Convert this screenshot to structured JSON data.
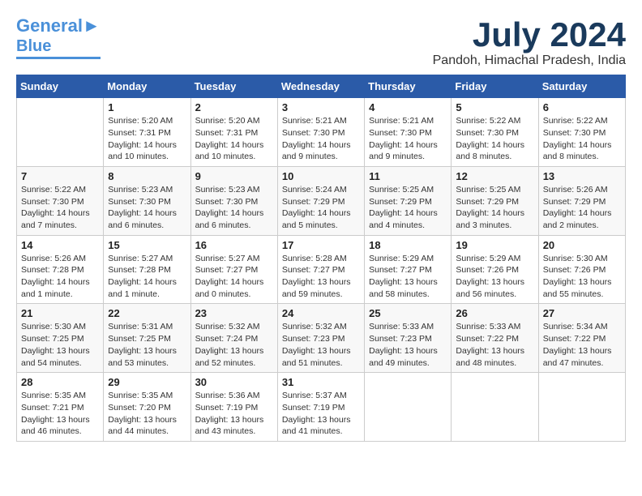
{
  "logo": {
    "line1": "General",
    "line2": "Blue"
  },
  "title": "July 2024",
  "location": "Pandoh, Himachal Pradesh, India",
  "days_of_week": [
    "Sunday",
    "Monday",
    "Tuesday",
    "Wednesday",
    "Thursday",
    "Friday",
    "Saturday"
  ],
  "weeks": [
    [
      {
        "day": "",
        "sunrise": "",
        "sunset": "",
        "daylight": ""
      },
      {
        "day": "1",
        "sunrise": "Sunrise: 5:20 AM",
        "sunset": "Sunset: 7:31 PM",
        "daylight": "Daylight: 14 hours and 10 minutes."
      },
      {
        "day": "2",
        "sunrise": "Sunrise: 5:20 AM",
        "sunset": "Sunset: 7:31 PM",
        "daylight": "Daylight: 14 hours and 10 minutes."
      },
      {
        "day": "3",
        "sunrise": "Sunrise: 5:21 AM",
        "sunset": "Sunset: 7:30 PM",
        "daylight": "Daylight: 14 hours and 9 minutes."
      },
      {
        "day": "4",
        "sunrise": "Sunrise: 5:21 AM",
        "sunset": "Sunset: 7:30 PM",
        "daylight": "Daylight: 14 hours and 9 minutes."
      },
      {
        "day": "5",
        "sunrise": "Sunrise: 5:22 AM",
        "sunset": "Sunset: 7:30 PM",
        "daylight": "Daylight: 14 hours and 8 minutes."
      },
      {
        "day": "6",
        "sunrise": "Sunrise: 5:22 AM",
        "sunset": "Sunset: 7:30 PM",
        "daylight": "Daylight: 14 hours and 8 minutes."
      }
    ],
    [
      {
        "day": "7",
        "sunrise": "Sunrise: 5:22 AM",
        "sunset": "Sunset: 7:30 PM",
        "daylight": "Daylight: 14 hours and 7 minutes."
      },
      {
        "day": "8",
        "sunrise": "Sunrise: 5:23 AM",
        "sunset": "Sunset: 7:30 PM",
        "daylight": "Daylight: 14 hours and 6 minutes."
      },
      {
        "day": "9",
        "sunrise": "Sunrise: 5:23 AM",
        "sunset": "Sunset: 7:30 PM",
        "daylight": "Daylight: 14 hours and 6 minutes."
      },
      {
        "day": "10",
        "sunrise": "Sunrise: 5:24 AM",
        "sunset": "Sunset: 7:29 PM",
        "daylight": "Daylight: 14 hours and 5 minutes."
      },
      {
        "day": "11",
        "sunrise": "Sunrise: 5:25 AM",
        "sunset": "Sunset: 7:29 PM",
        "daylight": "Daylight: 14 hours and 4 minutes."
      },
      {
        "day": "12",
        "sunrise": "Sunrise: 5:25 AM",
        "sunset": "Sunset: 7:29 PM",
        "daylight": "Daylight: 14 hours and 3 minutes."
      },
      {
        "day": "13",
        "sunrise": "Sunrise: 5:26 AM",
        "sunset": "Sunset: 7:29 PM",
        "daylight": "Daylight: 14 hours and 2 minutes."
      }
    ],
    [
      {
        "day": "14",
        "sunrise": "Sunrise: 5:26 AM",
        "sunset": "Sunset: 7:28 PM",
        "daylight": "Daylight: 14 hours and 1 minute."
      },
      {
        "day": "15",
        "sunrise": "Sunrise: 5:27 AM",
        "sunset": "Sunset: 7:28 PM",
        "daylight": "Daylight: 14 hours and 1 minute."
      },
      {
        "day": "16",
        "sunrise": "Sunrise: 5:27 AM",
        "sunset": "Sunset: 7:27 PM",
        "daylight": "Daylight: 14 hours and 0 minutes."
      },
      {
        "day": "17",
        "sunrise": "Sunrise: 5:28 AM",
        "sunset": "Sunset: 7:27 PM",
        "daylight": "Daylight: 13 hours and 59 minutes."
      },
      {
        "day": "18",
        "sunrise": "Sunrise: 5:29 AM",
        "sunset": "Sunset: 7:27 PM",
        "daylight": "Daylight: 13 hours and 58 minutes."
      },
      {
        "day": "19",
        "sunrise": "Sunrise: 5:29 AM",
        "sunset": "Sunset: 7:26 PM",
        "daylight": "Daylight: 13 hours and 56 minutes."
      },
      {
        "day": "20",
        "sunrise": "Sunrise: 5:30 AM",
        "sunset": "Sunset: 7:26 PM",
        "daylight": "Daylight: 13 hours and 55 minutes."
      }
    ],
    [
      {
        "day": "21",
        "sunrise": "Sunrise: 5:30 AM",
        "sunset": "Sunset: 7:25 PM",
        "daylight": "Daylight: 13 hours and 54 minutes."
      },
      {
        "day": "22",
        "sunrise": "Sunrise: 5:31 AM",
        "sunset": "Sunset: 7:25 PM",
        "daylight": "Daylight: 13 hours and 53 minutes."
      },
      {
        "day": "23",
        "sunrise": "Sunrise: 5:32 AM",
        "sunset": "Sunset: 7:24 PM",
        "daylight": "Daylight: 13 hours and 52 minutes."
      },
      {
        "day": "24",
        "sunrise": "Sunrise: 5:32 AM",
        "sunset": "Sunset: 7:23 PM",
        "daylight": "Daylight: 13 hours and 51 minutes."
      },
      {
        "day": "25",
        "sunrise": "Sunrise: 5:33 AM",
        "sunset": "Sunset: 7:23 PM",
        "daylight": "Daylight: 13 hours and 49 minutes."
      },
      {
        "day": "26",
        "sunrise": "Sunrise: 5:33 AM",
        "sunset": "Sunset: 7:22 PM",
        "daylight": "Daylight: 13 hours and 48 minutes."
      },
      {
        "day": "27",
        "sunrise": "Sunrise: 5:34 AM",
        "sunset": "Sunset: 7:22 PM",
        "daylight": "Daylight: 13 hours and 47 minutes."
      }
    ],
    [
      {
        "day": "28",
        "sunrise": "Sunrise: 5:35 AM",
        "sunset": "Sunset: 7:21 PM",
        "daylight": "Daylight: 13 hours and 46 minutes."
      },
      {
        "day": "29",
        "sunrise": "Sunrise: 5:35 AM",
        "sunset": "Sunset: 7:20 PM",
        "daylight": "Daylight: 13 hours and 44 minutes."
      },
      {
        "day": "30",
        "sunrise": "Sunrise: 5:36 AM",
        "sunset": "Sunset: 7:19 PM",
        "daylight": "Daylight: 13 hours and 43 minutes."
      },
      {
        "day": "31",
        "sunrise": "Sunrise: 5:37 AM",
        "sunset": "Sunset: 7:19 PM",
        "daylight": "Daylight: 13 hours and 41 minutes."
      },
      {
        "day": "",
        "sunrise": "",
        "sunset": "",
        "daylight": ""
      },
      {
        "day": "",
        "sunrise": "",
        "sunset": "",
        "daylight": ""
      },
      {
        "day": "",
        "sunrise": "",
        "sunset": "",
        "daylight": ""
      }
    ]
  ]
}
